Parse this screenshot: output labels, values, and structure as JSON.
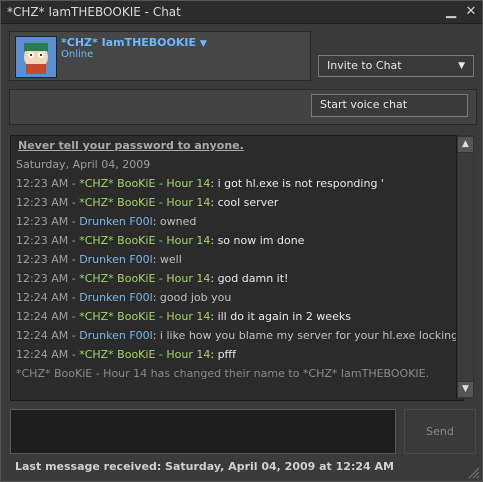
{
  "window": {
    "title": "*CHZ* IamTHEBOOKIE - Chat",
    "minimize_glyph": "▁",
    "close_glyph": "✕"
  },
  "header": {
    "name": "*CHZ* IamTHEBOOKIE",
    "name_arrow": "▼",
    "status": "Online"
  },
  "buttons": {
    "invite": "Invite to Chat",
    "invite_arrow": "▼",
    "voice": "Start voice chat",
    "send": "Send"
  },
  "chat": {
    "warning": "Never tell your password to anyone.",
    "date": "Saturday, April 04, 2009",
    "messages": [
      {
        "time": "12:23 AM",
        "name": "*CHZ* BooKiE - Hour 14",
        "text": "i got hl.exe is not responding '",
        "who": 1
      },
      {
        "time": "12:23 AM",
        "name": "*CHZ* BooKiE - Hour 14",
        "text": "cool server",
        "who": 1
      },
      {
        "time": "12:23 AM",
        "name": "Drunken F00l",
        "text": "owned",
        "who": 2
      },
      {
        "time": "12:23 AM",
        "name": "*CHZ* BooKiE - Hour 14",
        "text": "so now im done",
        "who": 1
      },
      {
        "time": "12:23 AM",
        "name": "Drunken F00l",
        "text": "well",
        "who": 2
      },
      {
        "time": "12:23 AM",
        "name": "*CHZ* BooKiE - Hour 14",
        "text": "god damn it!",
        "who": 1
      },
      {
        "time": "12:24 AM",
        "name": "Drunken F00l",
        "text": "good job you",
        "who": 2
      },
      {
        "time": "12:24 AM",
        "name": "*CHZ* BooKiE - Hour 14",
        "text": "ill do it again in 2 weeks",
        "who": 1
      },
      {
        "time": "12:24 AM",
        "name": "Drunken F00l",
        "text": "i like how you blame my server for your hl.exe locking up",
        "who": 2
      },
      {
        "time": "12:24 AM",
        "name": "*CHZ* BooKiE - Hour 14",
        "text": "pfff",
        "who": 1
      }
    ],
    "system_message": "*CHZ* BooKiE - Hour 14 has changed their name to *CHZ* IamTHEBOOKIE."
  },
  "footer": {
    "last_message": "Last message received: Saturday, April 04, 2009 at 12:24 AM"
  },
  "icons": {
    "avatar": "avatar-icon",
    "scroll_up": "▲",
    "scroll_down": "▼",
    "resize_grip": "resize-grip-icon"
  },
  "colors": {
    "accent_name": "#6cb8ff",
    "speaker_1": "#a6d36a",
    "speaker_2": "#7ab6e6"
  }
}
